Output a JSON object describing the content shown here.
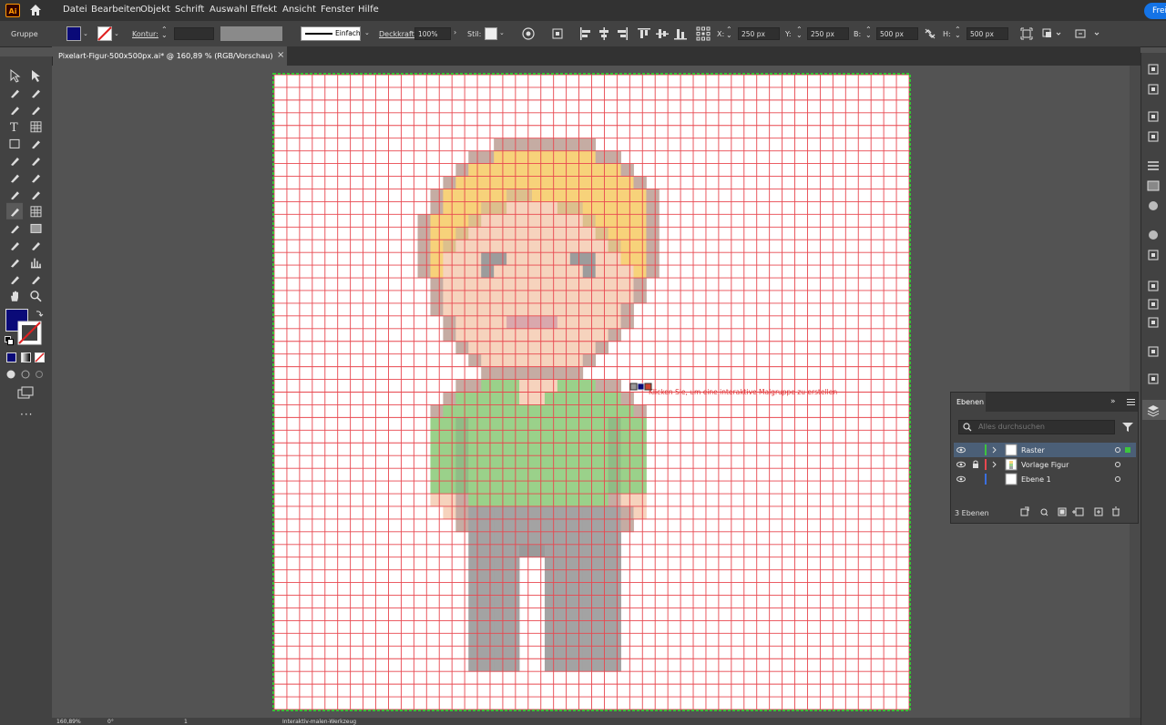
{
  "app": {
    "logo_text": "Ai"
  },
  "menu": {
    "items": [
      "Datei",
      "Bearbeiten",
      "Objekt",
      "Schrift",
      "Auswahl",
      "Effekt",
      "Ansicht",
      "Fenster",
      "Hilfe"
    ],
    "share_label": "Frei"
  },
  "control_bar": {
    "selection_type": "Gruppe",
    "fill_color": "#0a0a78",
    "stroke_label": "Kontur:",
    "stroke_style": "Einfach",
    "opacity_label": "Deckkraft:",
    "opacity_value": "100%",
    "style_label": "Stil:",
    "x_label": "X:",
    "x_value": "250 px",
    "y_label": "Y:",
    "y_value": "250 px",
    "w_label": "B:",
    "w_value": "500 px",
    "h_label": "H:",
    "h_value": "500 px"
  },
  "document": {
    "tab_title": "Pixelart-Figur-500x500px.ai* @ 160,89 % (RGB/Vorschau)",
    "close_icon": "×"
  },
  "canvas": {
    "hint": "Klicken Sie, um eine interaktive Malgruppe zu erstellen",
    "grid_color": "#e8474f",
    "pixel_grid_cells": 50,
    "colors": {
      "hair": "#f7d27a",
      "hair_dark": "#dcc08d",
      "skin": "#f6d3bd",
      "skin_dark": "#dcb2a1",
      "outline": "#c5aca3",
      "shirt": "#9ad18a",
      "shirt_dark": "#8fbc86",
      "pants": "#a3a3a3",
      "pants_dark": "#9a9a9a",
      "mouth": "#d9a8ad",
      "eye": "#9c9c9c"
    }
  },
  "layers_panel": {
    "tab": "Ebenen",
    "search_placeholder": "Alles durchsuchen",
    "layers": [
      {
        "name": "Raster",
        "color": "#3ec43e",
        "selected": true
      },
      {
        "name": "Vorlage Figur",
        "color": "#e8474f",
        "selected": false
      },
      {
        "name": "Ebene 1",
        "color": "#3a6fe0",
        "selected": false
      }
    ],
    "count": "3 Ebenen"
  },
  "status": {
    "zoom": "160,89%",
    "rotation": "0°",
    "artboard": "1",
    "tool": "Interaktiv-malen-Werkzeug"
  }
}
